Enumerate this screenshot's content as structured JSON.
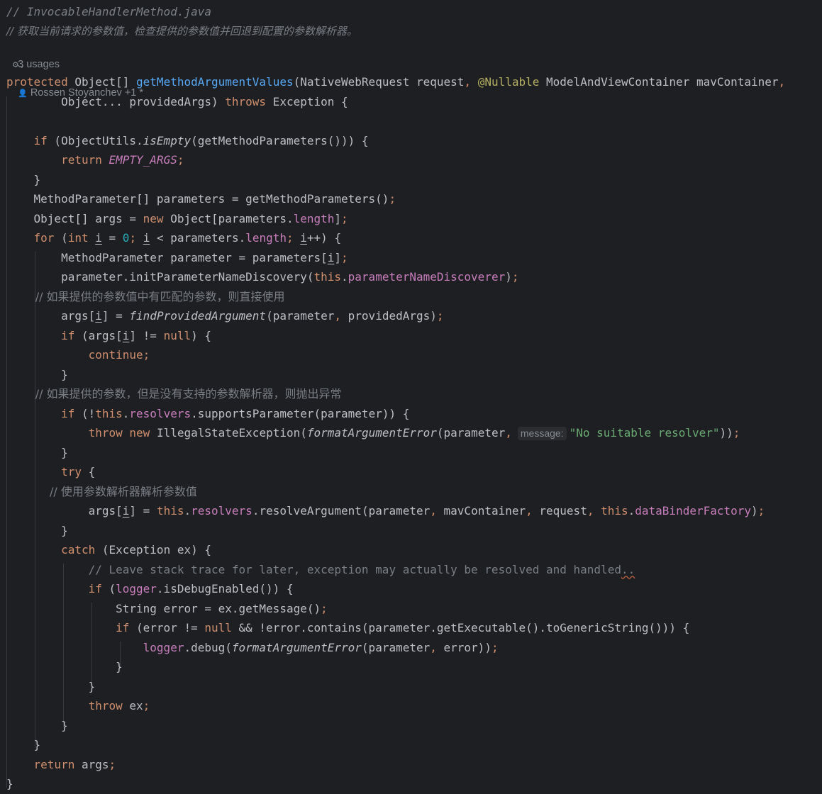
{
  "header": {
    "file_comment": "// InvocableHandlerMethod.java",
    "desc_comment": "// 获取当前请求的参数值，检查提供的参数值并回退到配置的参数解析器。",
    "usages": "3 usages",
    "authors": "Rossen Stoyanchev +1 *",
    "gear_icon": "gear-icon",
    "user_icon": "person-icon",
    "chevron_icon": "chevron-down-icon"
  },
  "code": [
    [
      [
        "protected",
        "kw"
      ],
      [
        " Object[] ",
        ""
      ],
      [
        "getMethodArgumentValues",
        "fn"
      ],
      [
        "(NativeWebRequest request",
        ""
      ],
      [
        ", ",
        "kw"
      ],
      [
        "@Nullable",
        "ann"
      ],
      [
        " ModelAndViewContainer mavContainer",
        ""
      ],
      [
        ",",
        "kw"
      ]
    ],
    [
      [
        "        Object... providedArgs) ",
        ""
      ],
      [
        "throws",
        "kw"
      ],
      [
        " Exception {",
        ""
      ]
    ],
    [],
    [
      [
        "    ",
        ""
      ],
      [
        "if",
        "kw"
      ],
      [
        " (ObjectUtils.",
        ""
      ],
      [
        "isEmpty",
        "it"
      ],
      [
        "(getMethodParameters())) {",
        ""
      ]
    ],
    [
      [
        "        ",
        ""
      ],
      [
        "return",
        "kw"
      ],
      [
        " ",
        ""
      ],
      [
        "EMPTY_ARGS",
        "stc"
      ],
      [
        ";",
        "kw"
      ]
    ],
    [
      [
        "    }",
        ""
      ]
    ],
    [
      [
        "    MethodParameter[] parameters = getMethodParameters()",
        ""
      ],
      [
        ";",
        "kw"
      ]
    ],
    [
      [
        "    Object[] args = ",
        ""
      ],
      [
        "new",
        "kw"
      ],
      [
        " Object[parameters.",
        ""
      ],
      [
        "length",
        "fld"
      ],
      [
        "]",
        ""
      ],
      [
        ";",
        "kw"
      ]
    ],
    [
      [
        "    ",
        ""
      ],
      [
        "for",
        "kw"
      ],
      [
        " (",
        ""
      ],
      [
        "int",
        "kw"
      ],
      [
        " ",
        ""
      ],
      [
        "i",
        "ul"
      ],
      [
        " = ",
        ""
      ],
      [
        "0",
        "num"
      ],
      [
        "; ",
        "kw"
      ],
      [
        "i",
        "ul"
      ],
      [
        " < parameters.",
        ""
      ],
      [
        "length",
        "fld"
      ],
      [
        "; ",
        "kw"
      ],
      [
        "i",
        "ul"
      ],
      [
        "++) {",
        ""
      ]
    ],
    [
      [
        "        MethodParameter parameter = parameters[",
        ""
      ],
      [
        "i",
        "ul"
      ],
      [
        "]",
        ""
      ],
      [
        ";",
        "kw"
      ]
    ],
    [
      [
        "        parameter.initParameterNameDiscovery(",
        ""
      ],
      [
        "this",
        "kw"
      ],
      [
        ".",
        ""
      ],
      [
        "parameterNameDiscoverer",
        "fld"
      ],
      [
        ")",
        ""
      ],
      [
        ";",
        "kw"
      ]
    ],
    [
      [
        "        // 如果提供的参数值中有匹配的参数，则直接使用",
        "cmt zh"
      ]
    ],
    [
      [
        "        args[",
        ""
      ],
      [
        "i",
        "ul"
      ],
      [
        "] = ",
        ""
      ],
      [
        "findProvidedArgument",
        "it"
      ],
      [
        "(parameter",
        ""
      ],
      [
        ", ",
        "kw"
      ],
      [
        "providedArgs)",
        ""
      ],
      [
        ";",
        "kw"
      ]
    ],
    [
      [
        "        ",
        ""
      ],
      [
        "if",
        "kw"
      ],
      [
        " (args[",
        ""
      ],
      [
        "i",
        "ul"
      ],
      [
        "] != ",
        ""
      ],
      [
        "null",
        "kw"
      ],
      [
        ") {",
        ""
      ]
    ],
    [
      [
        "            ",
        ""
      ],
      [
        "continue;",
        "kw"
      ]
    ],
    [
      [
        "        }",
        ""
      ]
    ],
    [
      [
        "        // 如果提供的参数，但是没有支持的参数解析器，则抛出异常",
        "cmt zh"
      ]
    ],
    [
      [
        "        ",
        ""
      ],
      [
        "if",
        "kw"
      ],
      [
        " (!",
        ""
      ],
      [
        "this",
        "kw"
      ],
      [
        ".",
        ""
      ],
      [
        "resolvers",
        "fld"
      ],
      [
        ".supportsParameter(parameter)) {",
        ""
      ]
    ],
    [
      [
        "            ",
        ""
      ],
      [
        "throw",
        "kw"
      ],
      [
        " ",
        ""
      ],
      [
        "new",
        "kw"
      ],
      [
        " IllegalStateException(",
        ""
      ],
      [
        "formatArgumentError",
        "it"
      ],
      [
        "(parameter",
        ""
      ],
      [
        ",",
        "kw"
      ],
      [
        "message:",
        "inlay"
      ],
      [
        "\"No suitable resolver\"",
        "str"
      ],
      [
        "))",
        ""
      ],
      [
        ";",
        "kw"
      ]
    ],
    [
      [
        "        }",
        ""
      ]
    ],
    [
      [
        "        ",
        ""
      ],
      [
        "try",
        "kw"
      ],
      [
        " {",
        ""
      ]
    ],
    [
      [
        "            // 使用参数解析器解析参数值",
        "cmt zh"
      ]
    ],
    [
      [
        "            args[",
        ""
      ],
      [
        "i",
        "ul"
      ],
      [
        "] = ",
        ""
      ],
      [
        "this",
        "kw"
      ],
      [
        ".",
        ""
      ],
      [
        "resolvers",
        "fld"
      ],
      [
        ".resolveArgument(parameter",
        ""
      ],
      [
        ", ",
        "kw"
      ],
      [
        "mavContainer",
        ""
      ],
      [
        ", ",
        "kw"
      ],
      [
        "request",
        ""
      ],
      [
        ", ",
        "kw"
      ],
      [
        "this",
        "kw"
      ],
      [
        ".",
        ""
      ],
      [
        "dataBinderFactory",
        "fld"
      ],
      [
        ")",
        ""
      ],
      [
        ";",
        "kw"
      ]
    ],
    [
      [
        "        }",
        ""
      ]
    ],
    [
      [
        "        ",
        ""
      ],
      [
        "catch",
        "kw"
      ],
      [
        " (Exception ex) {",
        ""
      ]
    ],
    [
      [
        "            // Leave stack trace for later, exception may actually be resolved and handled",
        "cmt"
      ],
      [
        "..",
        "dots"
      ]
    ],
    [
      [
        "            ",
        ""
      ],
      [
        "if",
        "kw"
      ],
      [
        " (",
        ""
      ],
      [
        "logger",
        "fld"
      ],
      [
        ".isDebugEnabled()) {",
        ""
      ]
    ],
    [
      [
        "                String error = ex.getMessage()",
        ""
      ],
      [
        ";",
        "kw"
      ]
    ],
    [
      [
        "                ",
        ""
      ],
      [
        "if",
        "kw"
      ],
      [
        " (error != ",
        ""
      ],
      [
        "null",
        "kw"
      ],
      [
        " && !error.contains(parameter.getExecutable().toGenericString())) {",
        ""
      ]
    ],
    [
      [
        "                    ",
        ""
      ],
      [
        "logger",
        "fld"
      ],
      [
        ".debug(",
        ""
      ],
      [
        "formatArgumentError",
        "it"
      ],
      [
        "(parameter",
        ""
      ],
      [
        ", ",
        "kw"
      ],
      [
        "error))",
        ""
      ],
      [
        ";",
        "kw"
      ]
    ],
    [
      [
        "                }",
        ""
      ]
    ],
    [
      [
        "            }",
        ""
      ]
    ],
    [
      [
        "            ",
        ""
      ],
      [
        "throw",
        "kw"
      ],
      [
        " ex",
        ""
      ],
      [
        ";",
        "kw"
      ]
    ],
    [
      [
        "        }",
        ""
      ]
    ],
    [
      [
        "    }",
        ""
      ]
    ],
    [
      [
        "    ",
        ""
      ],
      [
        "return",
        "kw"
      ],
      [
        " args",
        ""
      ],
      [
        ";",
        "kw"
      ]
    ],
    [
      [
        "}",
        ""
      ]
    ]
  ]
}
